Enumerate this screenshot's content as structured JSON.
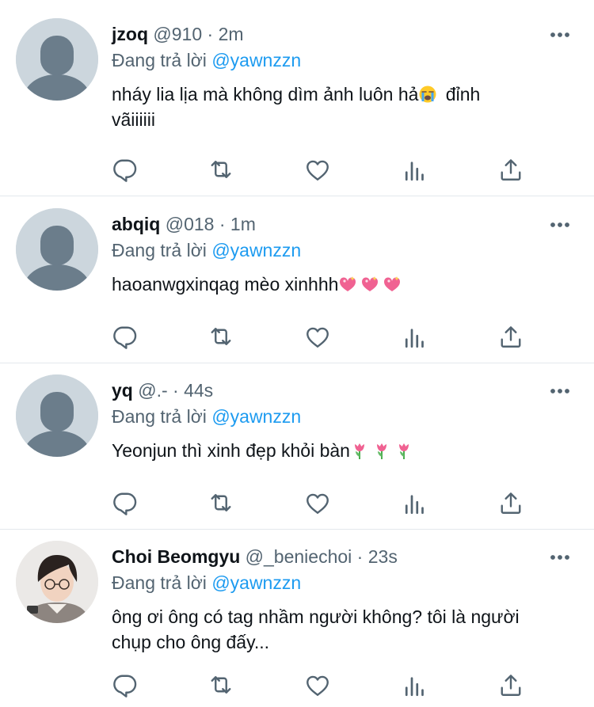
{
  "replies": [
    {
      "name": "jzoq",
      "handle": "@910",
      "time": "2m",
      "replying_prefix": "Đang trả lời",
      "replying_to": "@yawnzzn",
      "text_line1": "nháy lia lịa mà không dìm ảnh luôn hả",
      "text_line1_after": " đỉnh",
      "text_line2": "vãiiiiii",
      "emoji": "loudly-crying-face-emoji",
      "avatar": "default-avatar"
    },
    {
      "name": "abqiq",
      "handle": "@018",
      "time": "1m",
      "replying_prefix": "Đang trả lời",
      "replying_to": "@yawnzzn",
      "text": "haoanwgxinqag mèo xinhhh",
      "emoji": "sparkling-heart-emoji",
      "avatar": "default-avatar"
    },
    {
      "name": "yq",
      "handle": "@.-",
      "time": "44s",
      "replying_prefix": "Đang trả lời",
      "replying_to": "@yawnzzn",
      "text": "Yeonjun thì xinh đẹp khỏi bàn",
      "emoji": "tulip-emoji",
      "avatar": "default-avatar"
    },
    {
      "name": "Choi Beomgyu",
      "handle": "@_beniechoi",
      "time": "23s",
      "replying_prefix": "Đang trả lời",
      "replying_to": "@yawnzzn",
      "text_line1": "ông ơi ông có tag nhầm người không? tôi là người",
      "text_line2": "chụp cho ông đấy...",
      "avatar": "profile-photo"
    }
  ],
  "separator": " · ",
  "action_icons": [
    "reply-icon",
    "retweet-icon",
    "like-icon",
    "analytics-icon",
    "share-icon"
  ],
  "colors": {
    "link": "#1d9bf0",
    "secondary": "#536471",
    "text": "#0f1419",
    "avatar_bg": "#ccd6dd",
    "avatar_fg": "#6b7d8b"
  }
}
